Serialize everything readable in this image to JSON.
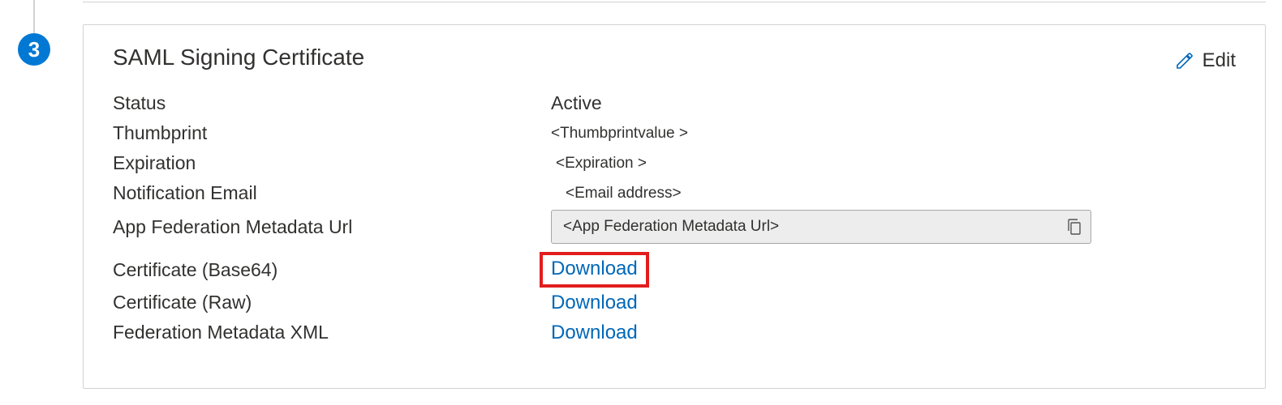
{
  "step": "3",
  "card": {
    "title": "SAML Signing Certificate",
    "edit_label": "Edit"
  },
  "fields": {
    "status_label": "Status",
    "status_value": "Active",
    "thumbprint_label": "Thumbprint",
    "thumbprint_value": "<Thumbprintvalue >",
    "expiration_label": "Expiration",
    "expiration_value": "<Expiration >",
    "notification_email_label": "Notification Email",
    "notification_email_value": "<Email address>",
    "app_fed_url_label": "App Federation Metadata Url",
    "app_fed_url_value": "<App Federation Metadata Url>",
    "cert_base64_label": "Certificate (Base64)",
    "cert_base64_link": "Download",
    "cert_raw_label": "Certificate (Raw)",
    "cert_raw_link": "Download",
    "fed_meta_xml_label": "Federation Metadata XML",
    "fed_meta_xml_link": "Download"
  }
}
